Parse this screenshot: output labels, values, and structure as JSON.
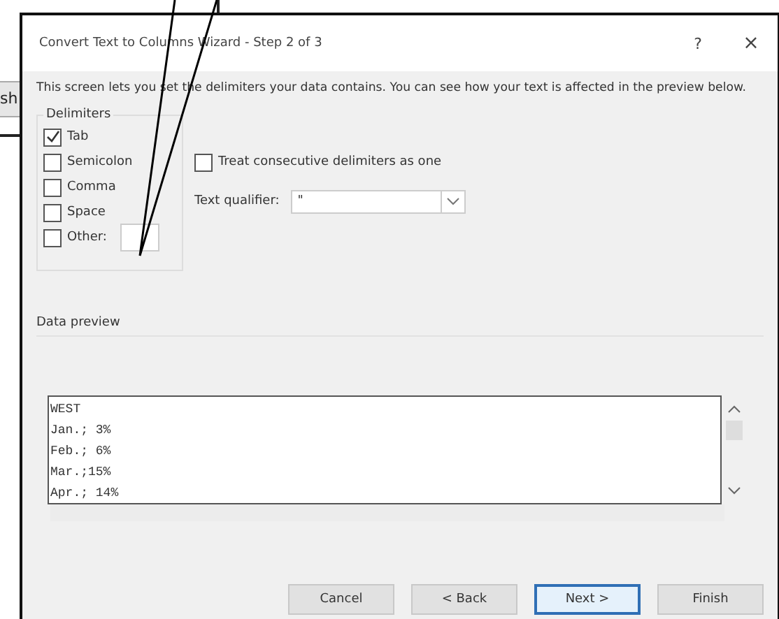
{
  "background_window": {
    "button_text": "sh"
  },
  "dialog": {
    "title": "Convert Text to Columns Wizard - Step 2 of 3",
    "help": "?",
    "close": "×",
    "description": "This screen lets you set the delimiters your data contains.  You can see how your text is affected in the preview below.",
    "delimiters": {
      "label": "Delimiters",
      "items": [
        {
          "label": "Tab",
          "checked": true
        },
        {
          "label": "Semicolon",
          "checked": false
        },
        {
          "label": "Comma",
          "checked": false
        },
        {
          "label": "Space",
          "checked": false
        },
        {
          "label": "Other:",
          "checked": false,
          "kind": "field"
        }
      ]
    },
    "consecutive": {
      "label": "Treat consecutive delimiters as one",
      "checked": false
    },
    "qualifier": {
      "label": "Text qualifier:",
      "value": "\""
    },
    "preview": {
      "label": "Data preview",
      "lines": [
        "WEST",
        "Jan.; 3%",
        "Feb.; 6%",
        "Mar.;15%",
        "Apr.; 14%"
      ]
    },
    "buttons": [
      {
        "label": "Cancel",
        "default": false
      },
      {
        "label": "< Back",
        "default": false
      },
      {
        "label": "Next >",
        "default": true
      },
      {
        "label": "Finish",
        "default": false
      }
    ]
  }
}
